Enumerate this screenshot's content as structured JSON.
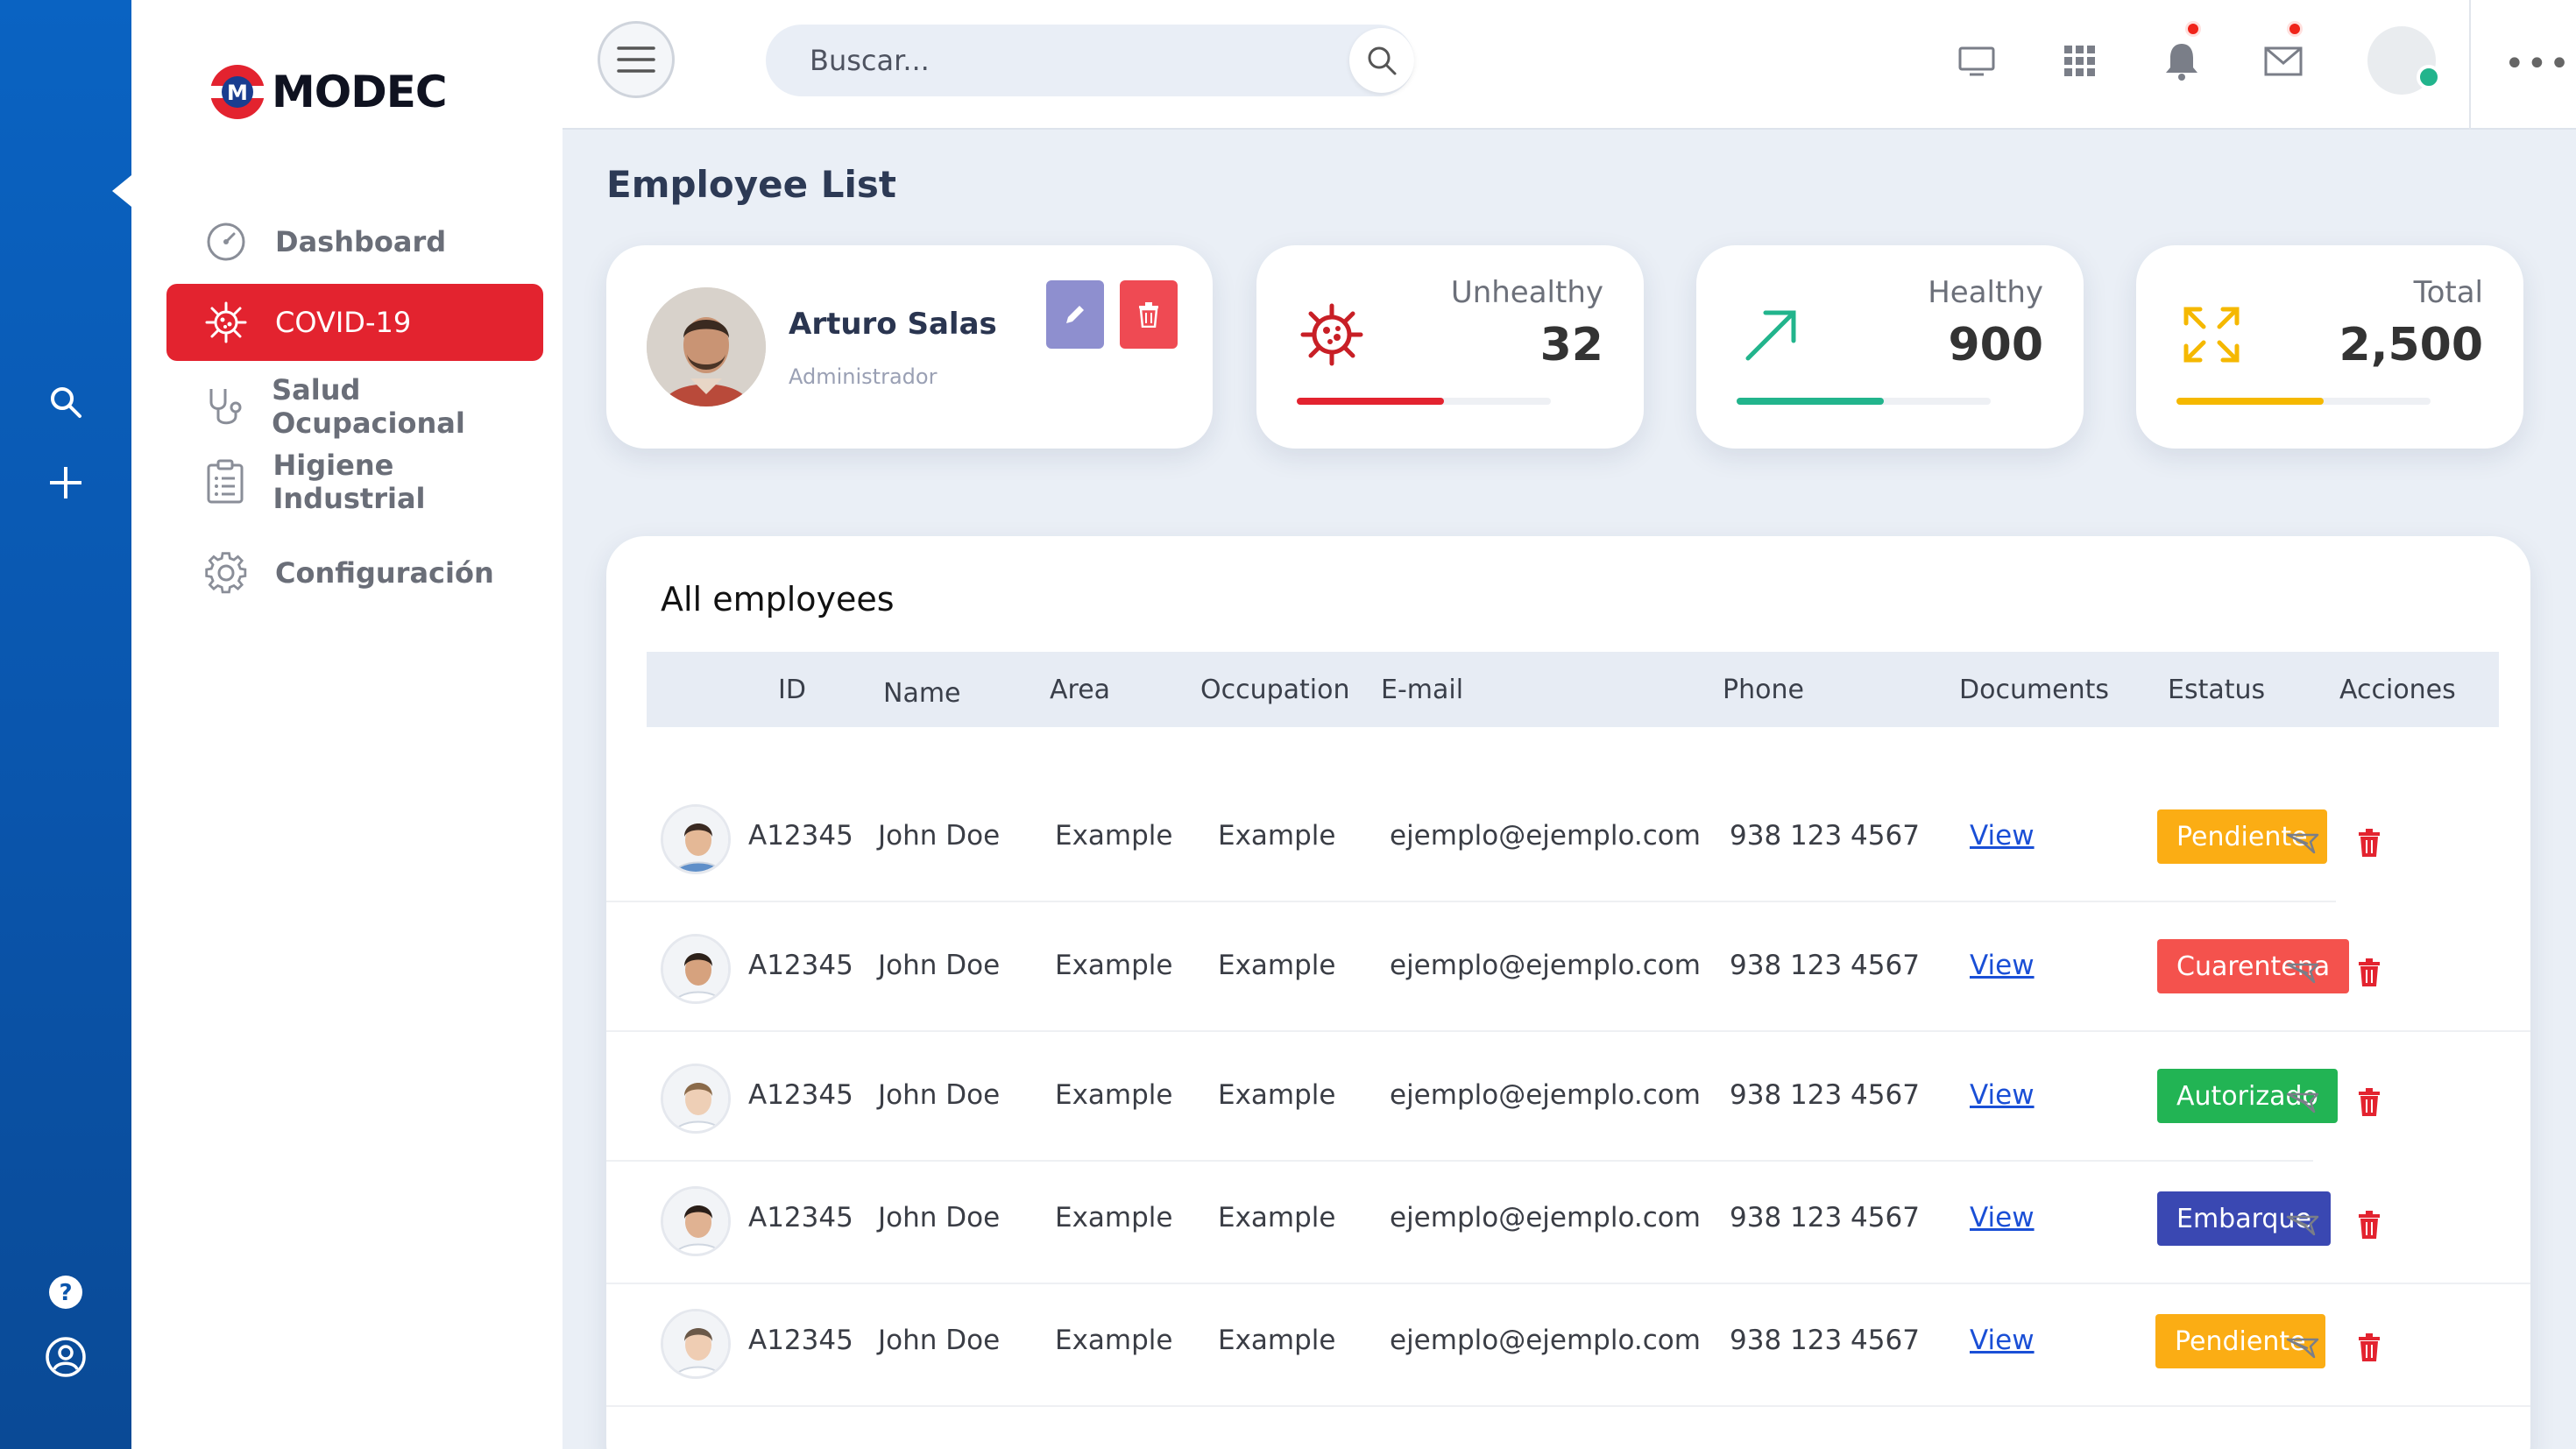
{
  "brand": {
    "logo_text": "MODEC",
    "accent": "#e3232f"
  },
  "sidebar": {
    "items": [
      {
        "label": "Dashboard",
        "icon": "gauge-icon"
      },
      {
        "label": "COVID-19",
        "icon": "virus-icon",
        "active": true
      },
      {
        "label": "Salud Ocupacional",
        "icon": "stethoscope-icon"
      },
      {
        "label": "Higiene Industrial",
        "icon": "clipboard-icon"
      },
      {
        "label": "Configuración",
        "icon": "gear-icon"
      }
    ]
  },
  "search": {
    "placeholder": "Buscar..."
  },
  "page": {
    "title": "Employee List"
  },
  "profile": {
    "name": "Arturo Salas",
    "role": "Administrador"
  },
  "stats": [
    {
      "label": "Unhealthy",
      "value": "32",
      "color": "#e3232f",
      "progress": 0.58
    },
    {
      "label": "Healthy",
      "value": "900",
      "color": "#22b48c",
      "progress": 0.58
    },
    {
      "label": "Total",
      "value": "2,500",
      "color": "#f5b800",
      "progress": 0.58
    }
  ],
  "table": {
    "title": "All employees",
    "columns": [
      "ID",
      "Name",
      "Area",
      "Occupation",
      "E-mail",
      "Phone",
      "Documents",
      "Estatus",
      "Acciones"
    ],
    "rows": [
      {
        "id": "A12345",
        "name": "John Doe",
        "area": "Example",
        "occupation": "Example",
        "email": "ejemplo@ejemplo.com",
        "phone": "938 123 4567",
        "documents": "View",
        "status": "Pendiente",
        "status_color": "#fbad14"
      },
      {
        "id": "A12345",
        "name": "John Doe",
        "area": "Example",
        "occupation": "Example",
        "email": "ejemplo@ejemplo.com",
        "phone": "938 123 4567",
        "documents": "View",
        "status": "Cuarentena",
        "status_color": "#f4524d"
      },
      {
        "id": "A12345",
        "name": "John Doe",
        "area": "Example",
        "occupation": "Example",
        "email": "ejemplo@ejemplo.com",
        "phone": "938 123 4567",
        "documents": "View",
        "status": "Autorizado",
        "status_color": "#22b454"
      },
      {
        "id": "A12345",
        "name": "John Doe",
        "area": "Example",
        "occupation": "Example",
        "email": "ejemplo@ejemplo.com",
        "phone": "938 123 4567",
        "documents": "View",
        "status": "Embarque",
        "status_color": "#3a48b2"
      },
      {
        "id": "A12345",
        "name": "John Doe",
        "area": "Example",
        "occupation": "Example",
        "email": "ejemplo@ejemplo.com",
        "phone": "938 123 4567",
        "documents": "View",
        "status": "Pendiente",
        "status_color": "#fbad14"
      }
    ]
  }
}
